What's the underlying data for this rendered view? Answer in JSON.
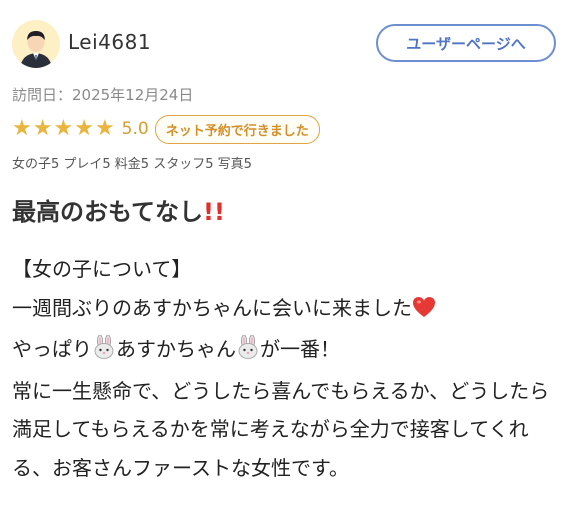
{
  "user": {
    "name": "Lei4681",
    "avatar_icon": "user-avatar-icon"
  },
  "header": {
    "user_page_label": "ユーザーページへ"
  },
  "visit": {
    "date_label": "訪問日：2025年12月24日"
  },
  "rating": {
    "stars": 5,
    "max_stars": 5,
    "score": "5.0",
    "booking_badge": "ネット予約で行きました",
    "sub_scores": "女の子5 プレイ5 料金5 スタッフ5 写真5"
  },
  "review": {
    "title": "最高のおもてなし",
    "title_emoji": "!!",
    "line1": "【女の子について】",
    "line2": "一週間ぶりのあすかちゃんに会いに来ました",
    "line3a": "やっぱり",
    "line3b": "あすかちゃん",
    "line3c": "が一番！",
    "line4": "常に一生懸命で、どうしたら喜んでもらえるか、どうしたら満足してもらえるかを常に考えながら全力で接客してくれる、お客さんファーストな女性です。"
  },
  "colors": {
    "star": "#e8b53e",
    "badge_border": "#e0a545",
    "user_button": "#6d8fcf",
    "title_emoji": "#e0302a"
  }
}
